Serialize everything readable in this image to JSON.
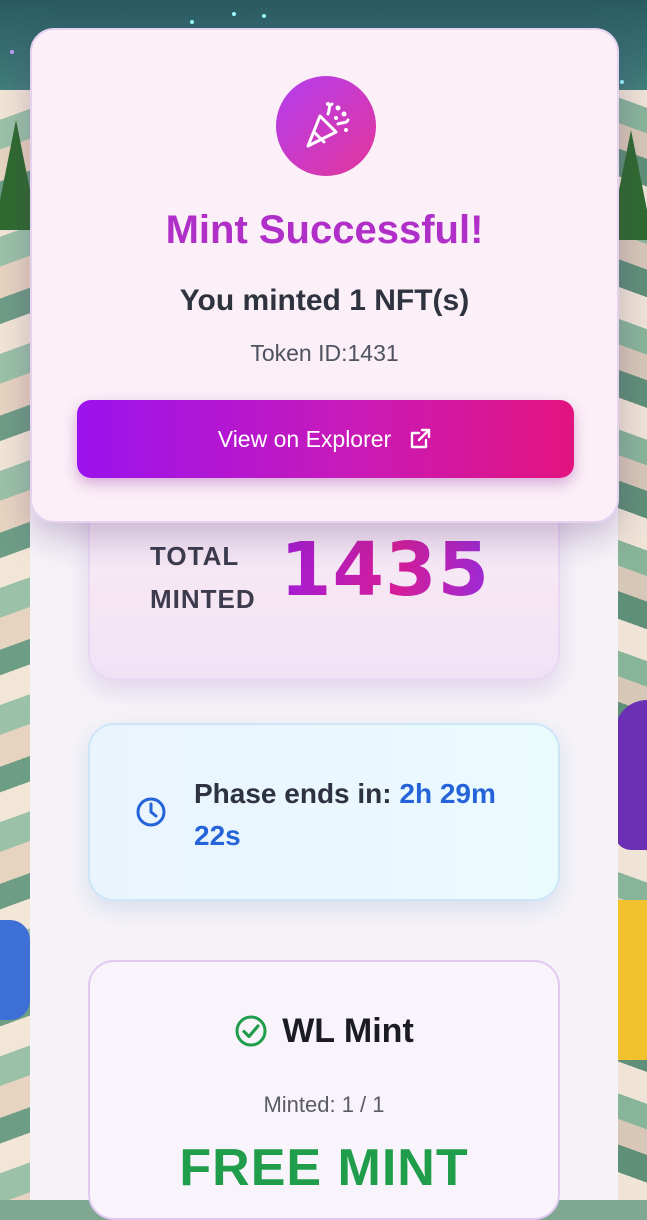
{
  "colors": {
    "title_gradient": "#b02fc9",
    "button_start": "#9b12ee",
    "button_end": "#e3137f",
    "phase_time": "#2563d8",
    "free_mint": "#1f9d4a"
  },
  "modal": {
    "icon": "party-popper-icon",
    "title": "Mint Successful!",
    "subtitle": "You minted 1 NFT(s)",
    "token": "Token ID:1431",
    "button_label": "View on Explorer",
    "button_icon": "external-link-icon"
  },
  "total": {
    "label_line1": "TOTAL",
    "label_line2": "MINTED",
    "value": "1435"
  },
  "phase": {
    "icon": "clock-icon",
    "label": "Phase ends in: ",
    "time_line1": "2h 29m",
    "time_line2": "22s"
  },
  "wl": {
    "icon": "check-circle-icon",
    "title": "WL Mint",
    "minted": "Minted: 1 / 1",
    "price": "FREE MINT"
  }
}
